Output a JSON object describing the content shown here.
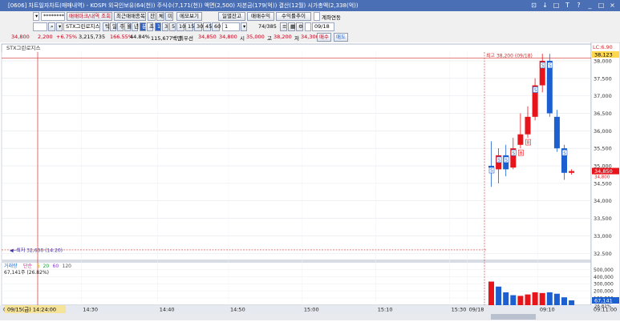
{
  "window": {
    "title": "[0606] 차트일자차트(매매내역) - KOSPI 외국인보유(64(천)) 주식수(7,171(천)) 액면(2,500) 자본금(179(억)) 결산(12월) 시가총액(2,338(억))",
    "controls": [
      "⊡",
      "↓",
      "□",
      "T",
      "?",
      "_",
      "□",
      "×"
    ]
  },
  "toolbar1": {
    "account": "********",
    "btn_trade_mark": "매매마크/내역 조회",
    "btn_recent": "최근매매종목",
    "btn_jan": "잔",
    "btn_che": "체",
    "btn_mi": "미",
    "btn_memo": "메모보기",
    "btn_daily_balance": "일별잔고",
    "btn_trade_profit": "매매수익",
    "btn_profit_chart": "수익률추이",
    "account_link_label": "계좌연동"
  },
  "toolbar2": {
    "code_value": "",
    "stock_name": "STX그린로지스",
    "periods": [
      "틱",
      "일",
      "주",
      "월",
      "년",
      "분",
      "초",
      "1",
      "3",
      "5",
      "10",
      "15",
      "30",
      "45",
      "60"
    ],
    "selected_periods": [
      "분",
      "1"
    ],
    "tick_count": "1",
    "display_count": "74/385",
    "date_value": "09/18"
  },
  "quote": {
    "price": "34,800",
    "change": "2,200",
    "change_rate": "+6.75%",
    "volume": "3,215,735",
    "vol_rate": "166.55%",
    "turnover": "44.84%",
    "amount": "115,677백만",
    "best_ask_label": "최우선",
    "best_ask": "34,850",
    "best_bid": "34,800",
    "open_label": "시",
    "open": "35,000",
    "high_label": "고",
    "high": "38,200",
    "low_label": "저",
    "low": "34,300",
    "buy_label": "매수",
    "sell_label": "매도"
  },
  "chart_labels": {
    "legend": "STX그린로지스",
    "high_annot": "최고 38,200 (09/18)",
    "low_annot": "최저 32,600 (14:20)",
    "right_top_label": "LC:6.90",
    "right_top_price": "38,123",
    "price_tag": "34,850",
    "price_tag2": "34,800",
    "vol_legend": [
      "거래량",
      "단순",
      "5",
      "20",
      "60",
      "120"
    ],
    "vol_value": "67,141주 (26.82%)",
    "vol_tag": "67,141",
    "vol_tag2": "26.82%",
    "cursor_time": "09/15(금) 14:24:00",
    "bottom_right_time": "09:11:00"
  },
  "colors": {
    "up": "#e8141c",
    "down": "#1c5fd0",
    "title": "#4a6fb5",
    "crosshair": "#d03030"
  },
  "chart_data": {
    "type": "candlestick",
    "y_ticks": [
      32500,
      33000,
      33500,
      34000,
      34500,
      35000,
      35500,
      36000,
      36500,
      37000,
      37500,
      38000
    ],
    "y_tick_labels": [
      "32.500",
      "33,000",
      "33,500",
      "34,000",
      "34,500",
      "35,000",
      "35,500",
      "36,000",
      "36,500",
      "37,000",
      "37,500",
      "38,000"
    ],
    "ylim": [
      32300,
      38250
    ],
    "x_ticks": [
      {
        "label": "09/",
        "pos": 0.0
      },
      {
        "label": "14:30",
        "pos": 0.135
      },
      {
        "label": "14:40",
        "pos": 0.265
      },
      {
        "label": "14:50",
        "pos": 0.385
      },
      {
        "label": "15:00",
        "pos": 0.51
      },
      {
        "label": "15:10",
        "pos": 0.635
      },
      {
        "label": "15:30",
        "pos": 0.76
      },
      {
        "label": "09/18",
        "pos": 0.79
      },
      {
        "label": "09:10",
        "pos": 0.91
      }
    ],
    "candles": [
      {
        "t": "09:00",
        "o": 35000,
        "h": 35700,
        "l": 34400,
        "c": 34950,
        "mark": "S"
      },
      {
        "t": "09:01",
        "o": 34900,
        "h": 35500,
        "l": 34500,
        "c": 35300,
        "mark": "S"
      },
      {
        "t": "09:02",
        "o": 35300,
        "h": 35600,
        "l": 34700,
        "c": 34900,
        "mark": "S"
      },
      {
        "t": "09:03",
        "o": 34950,
        "h": 35800,
        "l": 34900,
        "c": 35500,
        "mark": "S"
      },
      {
        "t": "09:04",
        "o": 35600,
        "h": 36500,
        "l": 35500,
        "c": 35900,
        "mark": "B"
      },
      {
        "t": "09:05",
        "o": 35900,
        "h": 36700,
        "l": 35800,
        "c": 36400,
        "mark": "B"
      },
      {
        "t": "09:06",
        "o": 36400,
        "h": 37500,
        "l": 36300,
        "c": 37300,
        "mark": "S"
      },
      {
        "t": "09:07",
        "o": 37300,
        "h": 38200,
        "l": 37100,
        "c": 38000,
        "mark": "S"
      },
      {
        "t": "09:08",
        "o": 38000,
        "h": 38200,
        "l": 36400,
        "c": 36500,
        "mark": "S"
      },
      {
        "t": "09:09",
        "o": 36400,
        "h": 36600,
        "l": 35400,
        "c": 35500,
        "mark": ""
      },
      {
        "t": "09:10",
        "o": 35500,
        "h": 35600,
        "l": 34600,
        "c": 34800,
        "mark": "S"
      },
      {
        "t": "09:11",
        "o": 34800,
        "h": 34900,
        "l": 34750,
        "c": 34850,
        "mark": ""
      }
    ],
    "volume": [
      {
        "t": "09:00",
        "v": 330000,
        "dir": "up"
      },
      {
        "t": "09:01",
        "v": 260000,
        "dir": "down"
      },
      {
        "t": "09:02",
        "v": 180000,
        "dir": "down"
      },
      {
        "t": "09:03",
        "v": 140000,
        "dir": "down"
      },
      {
        "t": "09:04",
        "v": 130000,
        "dir": "up"
      },
      {
        "t": "09:05",
        "v": 150000,
        "dir": "up"
      },
      {
        "t": "09:06",
        "v": 180000,
        "dir": "up"
      },
      {
        "t": "09:07",
        "v": 170000,
        "dir": "up"
      },
      {
        "t": "09:08",
        "v": 180000,
        "dir": "down"
      },
      {
        "t": "09:09",
        "v": 160000,
        "dir": "down"
      },
      {
        "t": "09:10",
        "v": 110000,
        "dir": "down"
      },
      {
        "t": "09:11",
        "v": 67141,
        "dir": "down"
      }
    ],
    "vol_ticks": [
      100000,
      200000,
      300000,
      400000,
      500000
    ],
    "vol_tick_labels": [
      "100,000",
      "200,000",
      "300,000",
      "400,000",
      "500,000"
    ],
    "vol_ylim": [
      0,
      560000
    ]
  }
}
